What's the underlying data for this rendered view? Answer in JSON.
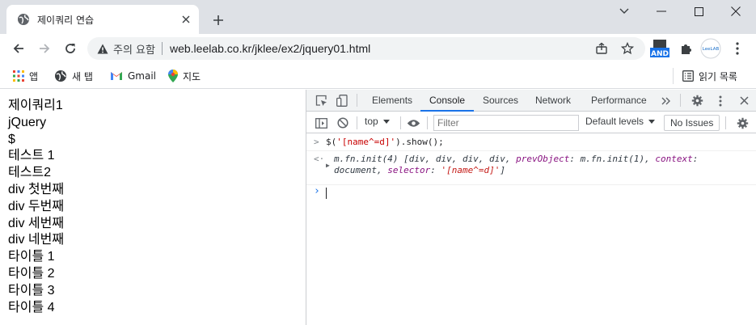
{
  "browser": {
    "tab_title": "제이쿼리 연습",
    "security_label": "주의 요함",
    "url": "web.leelab.co.kr/jklee/ex2/jquery01.html",
    "ext_badge": "AND",
    "profile_label": "LeeLAB"
  },
  "bookmarks": {
    "apps": "앱",
    "newtab": "새 탭",
    "gmail": "Gmail",
    "maps": "지도",
    "reading_list": "읽기 목록"
  },
  "page": {
    "lines": [
      "제이쿼리1",
      "jQuery",
      "$",
      "테스트 1",
      "테스트2",
      "div 첫번째",
      "div 두번째",
      "div 세번째",
      "div 네번째",
      "타이틀 1",
      "타이틀 2",
      "타이틀 3",
      "타이틀 4"
    ]
  },
  "devtools": {
    "tabs": [
      "Elements",
      "Console",
      "Sources",
      "Network",
      "Performance"
    ],
    "active_tab": "Console",
    "context": "top",
    "filter_placeholder": "Filter",
    "levels": "Default levels",
    "issues": "No Issues",
    "console": {
      "cmd_pre": "$(",
      "cmd_str": "'[name^=d]'",
      "cmd_post": ").show();",
      "result_l1": "m.fn.init(4) [div, div, div, div, ",
      "result_k1": "prevObject",
      "result_v1": ": m.fn.init(1), ",
      "result_k2": "context",
      "result_v2": ":",
      "result_l2": "document, ",
      "result_k3": "selector",
      "result_v3": ": ",
      "result_s3": "'[name^=d]'",
      "result_end": "]"
    }
  }
}
